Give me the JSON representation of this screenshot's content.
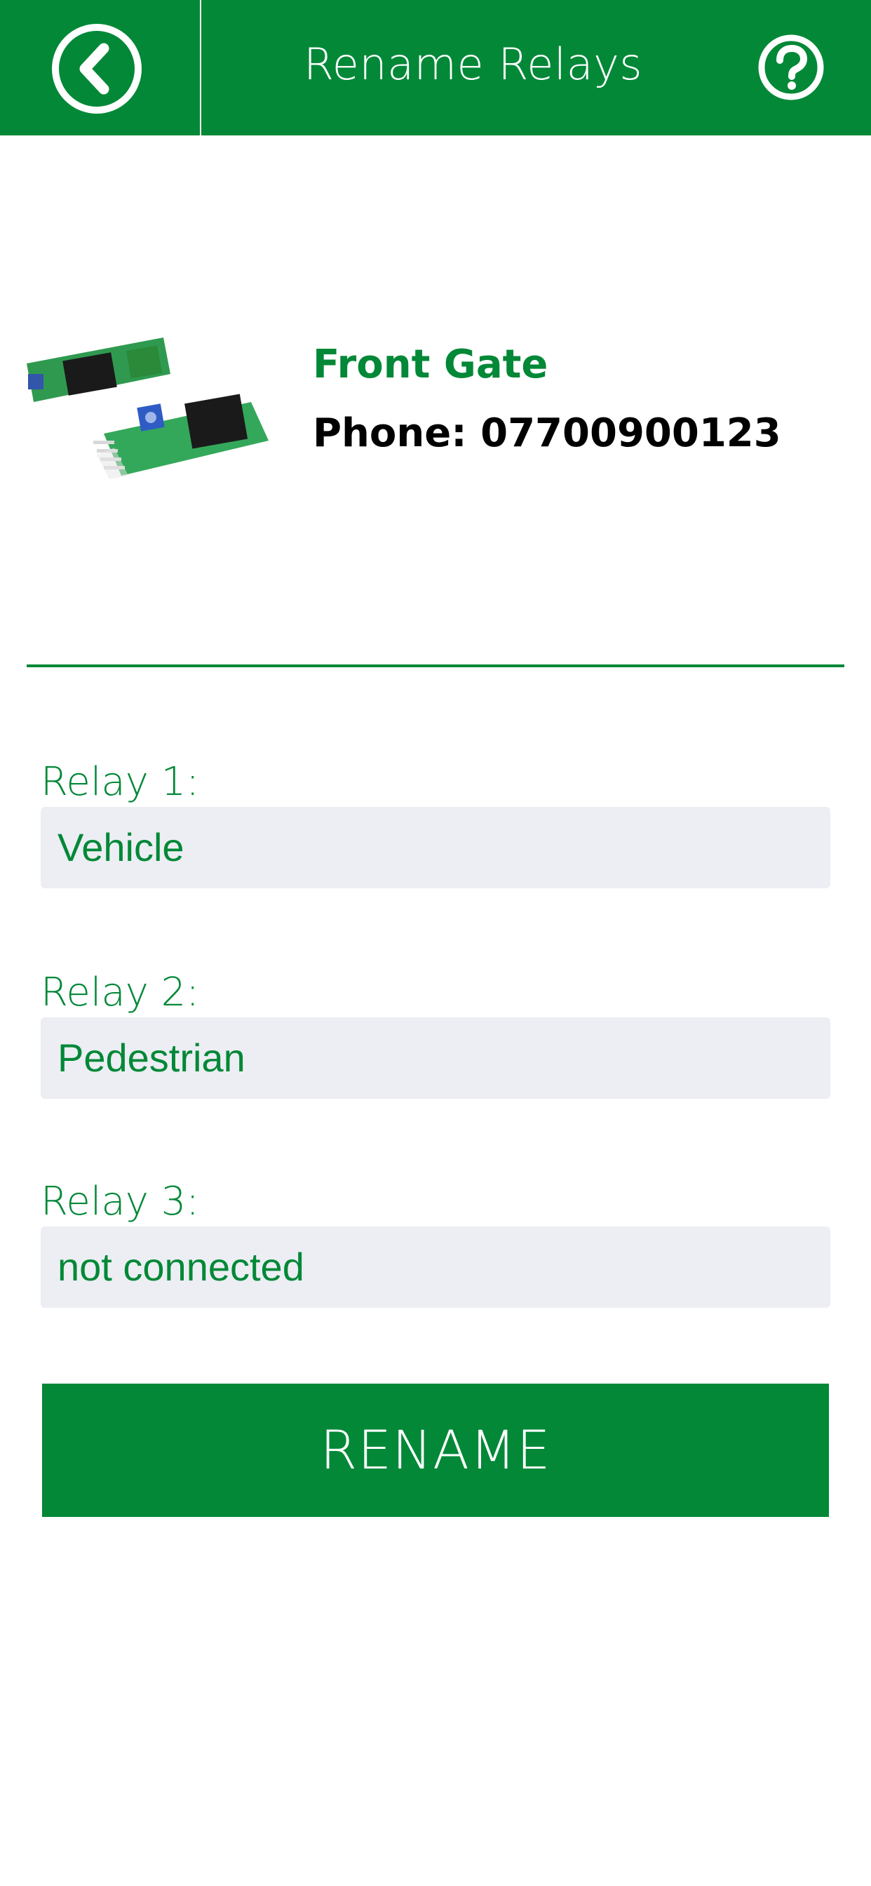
{
  "header": {
    "title": "Rename Relays",
    "back_icon": "chevron-left-circle-icon",
    "help_icon": "question-circle-icon"
  },
  "device": {
    "name": "Front Gate",
    "phone": "Phone: 07700900123",
    "image": "relay-board-photo"
  },
  "relays": [
    {
      "label": "Relay 1:",
      "value": "Vehicle"
    },
    {
      "label": "Relay 2:",
      "value": "Pedestrian"
    },
    {
      "label": "Relay 3:",
      "value": "not connected"
    }
  ],
  "actions": {
    "rename_label": "RENAME"
  },
  "colors": {
    "brand_green": "#028837",
    "field_background": "#eceef3",
    "white": "#ffffff"
  }
}
